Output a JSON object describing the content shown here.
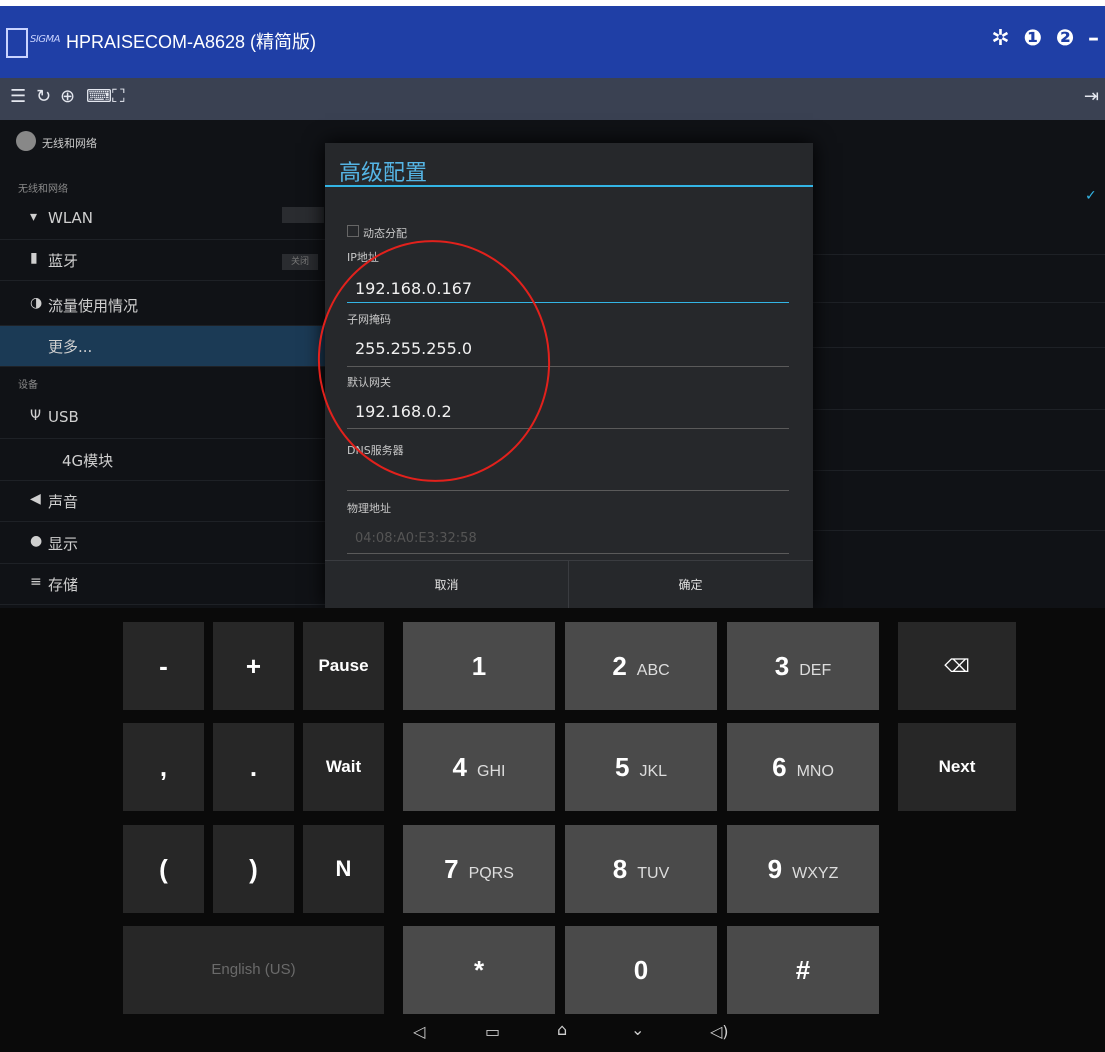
{
  "titlebar": {
    "brand": "SIGMA",
    "title": "HPRAISECOM-A8628 (精简版)",
    "icons": [
      "gear-icon",
      "info-icon",
      "help-icon",
      "minimize-icon"
    ]
  },
  "toolbar": {
    "left_icons": [
      "menu-icon",
      "refresh-icon",
      "zoom-icon",
      "keyboard-icon",
      "fullscreen-icon"
    ],
    "right_icon": "exit-icon"
  },
  "settings": {
    "header": "无线和网络",
    "categories": [
      "无线和网络",
      "设备"
    ],
    "items": [
      {
        "icon": "wifi-icon",
        "label": "WLAN"
      },
      {
        "icon": "bluetooth-icon",
        "label": "蓝牙"
      },
      {
        "icon": "data-usage-icon",
        "label": "流量使用情况"
      },
      {
        "icon": "",
        "label": "更多..."
      },
      {
        "icon": "usb-icon",
        "label": "USB"
      },
      {
        "icon": "",
        "label": "4G模块"
      },
      {
        "icon": "sound-icon",
        "label": "声音"
      },
      {
        "icon": "display-icon",
        "label": "显示"
      },
      {
        "icon": "storage-icon",
        "label": "存储"
      }
    ],
    "bt_toggle": "关闭"
  },
  "dialog": {
    "title": "高级配置",
    "dhcp_label": "动态分配",
    "ip_label": "IP地址",
    "ip_value": "192.168.0.167",
    "mask_label": "子网掩码",
    "mask_value": "255.255.255.0",
    "gateway_label": "默认网关",
    "gateway_value": "192.168.0.2",
    "dns_label": "DNS服务器",
    "dns_value": "",
    "mac_label": "物理地址",
    "mac_value": "04:08:A0:E3:32:58",
    "cancel": "取消",
    "ok": "确定"
  },
  "keyboard": {
    "rows": [
      [
        "-",
        "+",
        "Pause"
      ],
      [
        ",",
        ".",
        "Wait"
      ],
      [
        "(",
        ")",
        "N"
      ]
    ],
    "digits": [
      [
        "1",
        ""
      ],
      [
        "2",
        "ABC"
      ],
      [
        "3",
        "DEF"
      ],
      [
        "4",
        "GHI"
      ],
      [
        "5",
        "JKL"
      ],
      [
        "6",
        "MNO"
      ],
      [
        "7",
        "PQRS"
      ],
      [
        "8",
        "TUV"
      ],
      [
        "9",
        "WXYZ"
      ],
      [
        "*",
        ""
      ],
      [
        "0",
        ""
      ],
      [
        "#",
        ""
      ]
    ],
    "language": "English (US)",
    "next": "Next",
    "backspace_icon": "backspace-icon"
  },
  "navbar": {
    "icons": [
      "volume-down-icon",
      "recent-apps-icon",
      "home-icon",
      "hide-keyboard-icon",
      "volume-up-icon"
    ]
  },
  "colors": {
    "titlebar": "#1f3fa6",
    "accent": "#33b5e5",
    "annotation": "#e2211c"
  }
}
